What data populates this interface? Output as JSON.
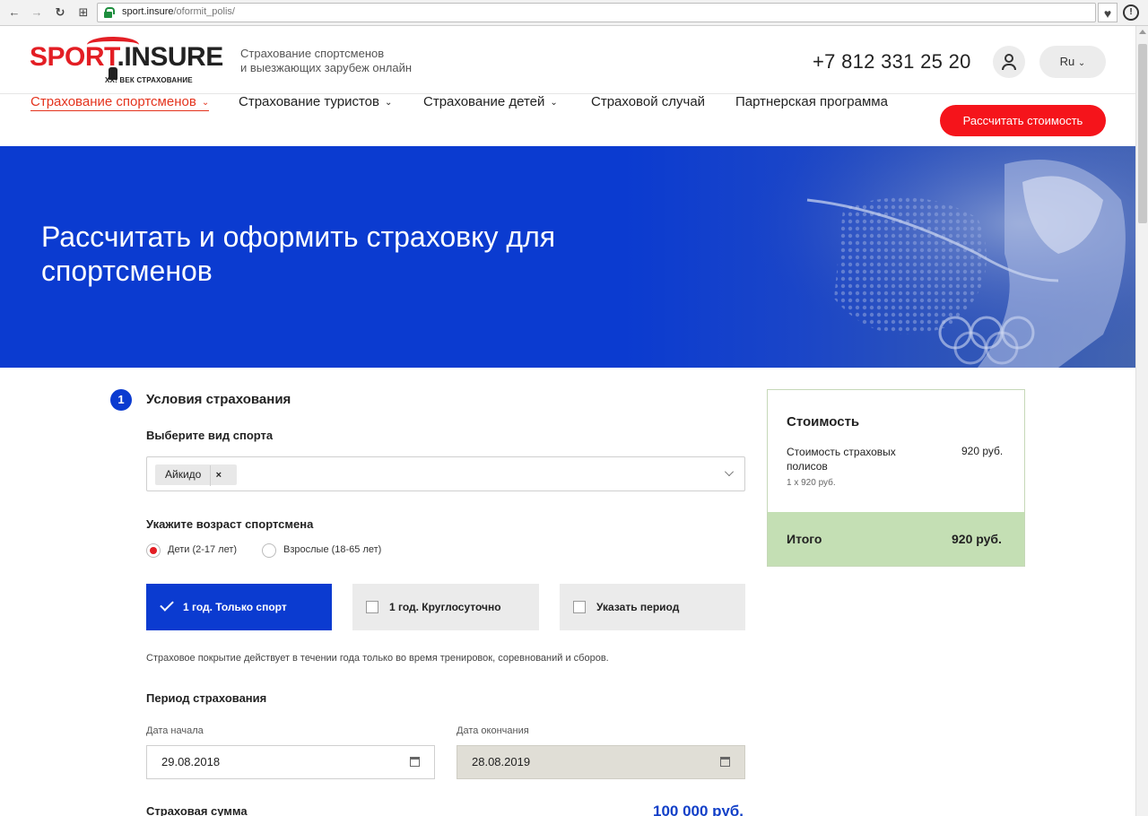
{
  "browser": {
    "url_host": "sport.insure",
    "url_path": "/oformit_polis/",
    "back_icon": "←",
    "forward_icon": "→",
    "reload_icon": "↻",
    "apps_icon": "⊞",
    "heart_icon": "♥",
    "menu_icon": "!"
  },
  "header": {
    "logo_brand_sport": "SPORT",
    "logo_brand_insure": ".INSURE",
    "logo_tagline": "XX! ВЕК СТРАХОВАНИЕ",
    "tagline_line1": "Страхование спортсменов",
    "tagline_line2": "и выезжающих зарубеж онлайн",
    "phone": "+7 812 331 25 20",
    "lang": "Ru",
    "lang_chevron": "⌄",
    "cta": "Рассчитать стоимость"
  },
  "nav": [
    {
      "label": "Страхование спортсменов",
      "chevron": "⌄"
    },
    {
      "label": "Страхование туристов",
      "chevron": "⌄"
    },
    {
      "label": "Страхование детей",
      "chevron": "⌄"
    },
    {
      "label": "Страховой случай",
      "chevron": ""
    },
    {
      "label": "Партнерская программа",
      "chevron": ""
    }
  ],
  "hero": {
    "title": "Рассчитать и оформить страховку для спортсменов"
  },
  "form": {
    "step_number": "1",
    "step_title": "Условия страхования",
    "sport_label": "Выберите вид спорта",
    "sport_selected": "Айкидо",
    "sport_remove": "×",
    "age_label": "Укажите возраст спортсмена",
    "age_options": [
      {
        "label": "Дети (2-17 лет)",
        "selected": true
      },
      {
        "label": "Взрослые (18-65 лет)",
        "selected": false
      }
    ],
    "period_options": [
      {
        "label": "1 год. Только спорт",
        "selected": true
      },
      {
        "label": "1 год. Круглосуточно",
        "selected": false
      },
      {
        "label": "Указать период",
        "selected": false
      }
    ],
    "coverage_note": "Страховое покрытие действует в течении года только во время тренировок, соревнований и сборов.",
    "period_label": "Период страхования",
    "start_label": "Дата начала",
    "start_value": "29.08.2018",
    "end_label": "Дата окончания",
    "end_value": "28.08.2019",
    "sum_label": "Страховая сумма",
    "sum_value": "100 000 руб."
  },
  "cost": {
    "title": "Стоимость",
    "row_label": "Стоимость страховых полисов",
    "row_value": "920 руб.",
    "row_sub": "1 х 920 руб.",
    "total_label": "Итого",
    "total_value": "920 руб."
  },
  "colors": {
    "brand_red": "#e31e24",
    "hero_blue": "#0b3bd0",
    "total_green": "#c4dfb4",
    "sum_blue": "#1240c8"
  }
}
